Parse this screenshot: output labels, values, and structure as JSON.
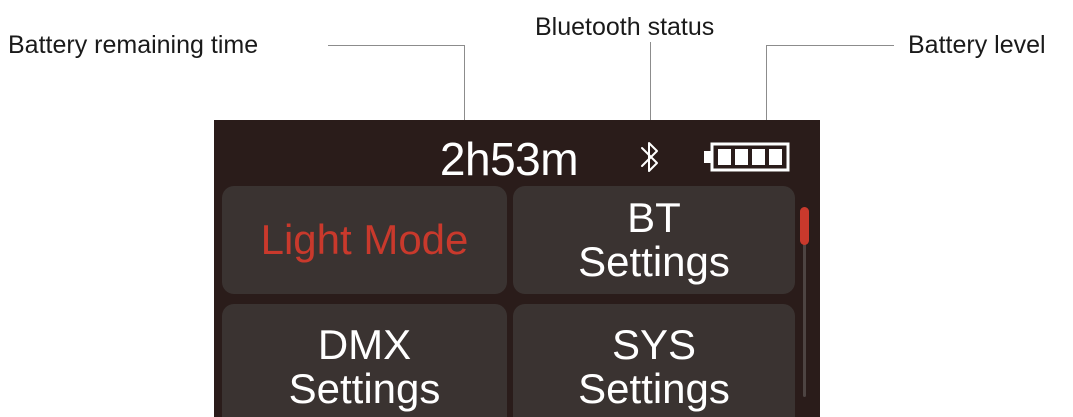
{
  "callouts": {
    "remaining_time": "Battery remaining time",
    "bluetooth": "Bluetooth status",
    "battery_level": "Battery level"
  },
  "status": {
    "remaining_time": "2h53m",
    "bluetooth_icon": "bluetooth-icon",
    "battery_icon": "battery-full-icon",
    "battery_bars": 4
  },
  "menu": {
    "light_mode": {
      "line1": "Light Mode",
      "active": true
    },
    "bt_settings": {
      "line1": "BT",
      "line2": "Settings"
    },
    "dmx_settings": {
      "line1": "DMX",
      "line2": "Settings"
    },
    "sys_settings": {
      "line1": "SYS",
      "line2": "Settings"
    }
  },
  "colors": {
    "screen_bg": "#2a1c1a",
    "tile_bg": "#3a3331",
    "accent": "#c9392c",
    "text": "#ffffff"
  }
}
